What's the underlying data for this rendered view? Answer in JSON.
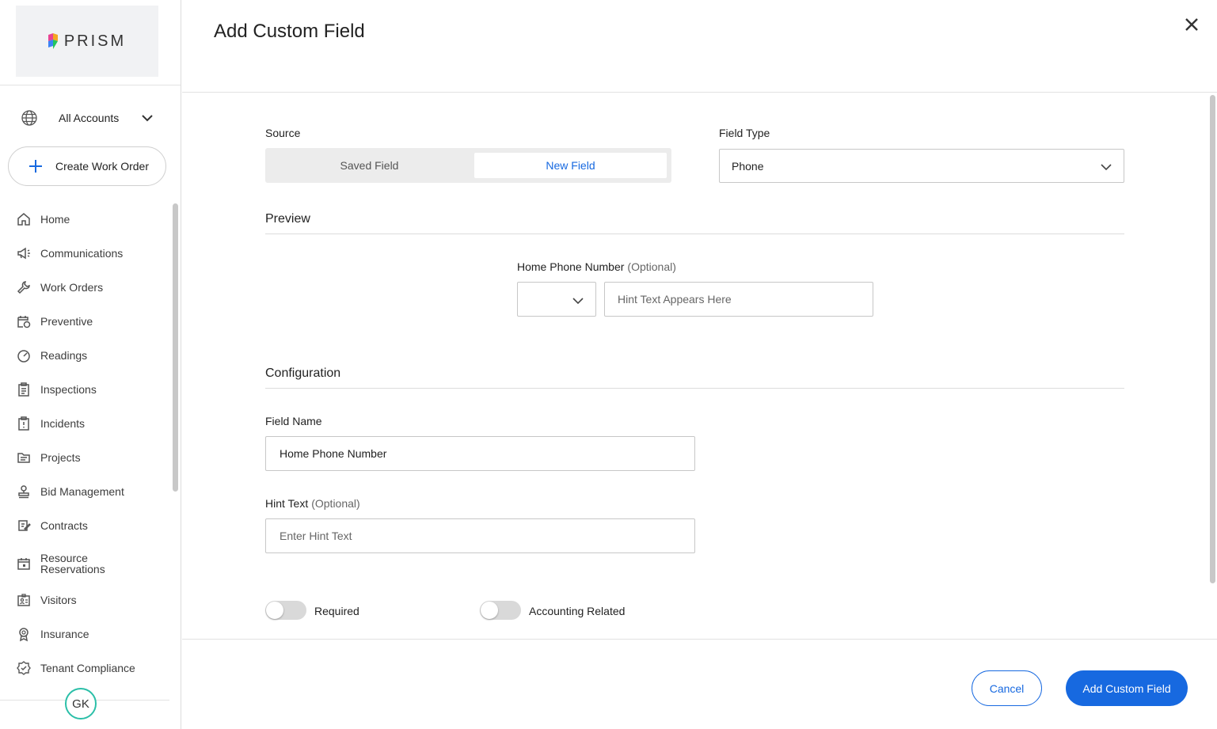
{
  "brand": {
    "name": "PRISM"
  },
  "sidebar": {
    "account_selector": {
      "label": "All Accounts",
      "icon": "globe-icon"
    },
    "create_button": {
      "label": "Create Work Order",
      "icon": "plus-icon"
    },
    "nav": [
      {
        "label": "Home",
        "icon": "home-icon"
      },
      {
        "label": "Communications",
        "icon": "megaphone-icon"
      },
      {
        "label": "Work Orders",
        "icon": "wrench-icon"
      },
      {
        "label": "Preventive",
        "icon": "calendar-clock-icon"
      },
      {
        "label": "Readings",
        "icon": "gauge-icon"
      },
      {
        "label": "Inspections",
        "icon": "clipboard-icon"
      },
      {
        "label": "Incidents",
        "icon": "alert-clipboard-icon"
      },
      {
        "label": "Projects",
        "icon": "folder-icon"
      },
      {
        "label": "Bid Management",
        "icon": "stamp-icon"
      },
      {
        "label": "Contracts",
        "icon": "contract-icon"
      },
      {
        "label": "Resource Reservations",
        "icon": "calendar-icon"
      },
      {
        "label": "Visitors",
        "icon": "visitor-badge-icon"
      },
      {
        "label": "Insurance",
        "icon": "award-icon"
      },
      {
        "label": "Tenant Compliance",
        "icon": "check-badge-icon"
      }
    ],
    "user_initials": "GK"
  },
  "modal": {
    "title": "Add Custom Field",
    "source": {
      "label": "Source",
      "options": [
        "Saved Field",
        "New Field"
      ],
      "selected": "New Field"
    },
    "field_type": {
      "label": "Field Type",
      "value": "Phone"
    },
    "preview": {
      "title": "Preview",
      "field_label": "Home Phone Number",
      "optional_tag": "(Optional)",
      "hint_placeholder": "Hint Text Appears Here"
    },
    "configuration": {
      "title": "Configuration",
      "field_name": {
        "label": "Field Name",
        "value": "Home Phone Number"
      },
      "hint_text": {
        "label": "Hint Text",
        "optional_tag": "(Optional)",
        "placeholder": "Enter Hint Text"
      },
      "toggles": [
        {
          "label": "Required",
          "on": false
        },
        {
          "label": "Accounting Related",
          "on": false
        }
      ]
    },
    "footer": {
      "cancel_label": "Cancel",
      "submit_label": "Add Custom Field"
    }
  },
  "colors": {
    "accent": "#1769e0",
    "avatar_ring": "#2bbfa8"
  }
}
